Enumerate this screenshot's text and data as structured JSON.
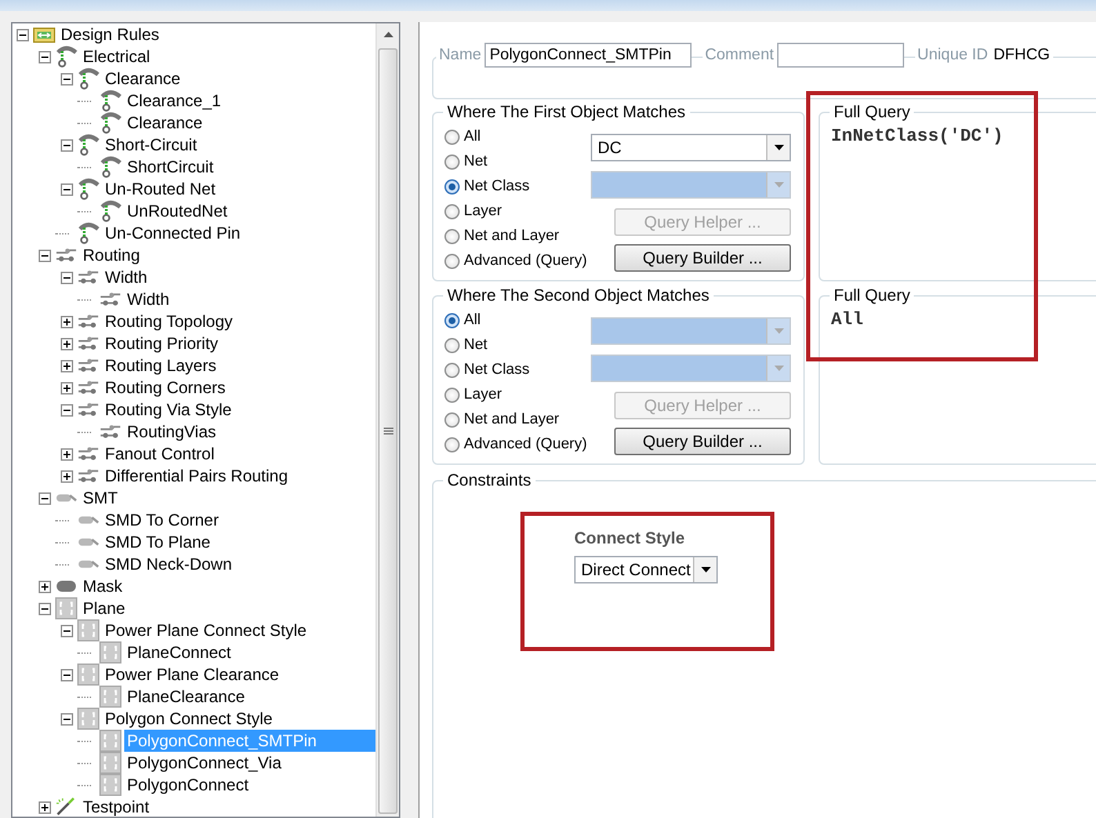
{
  "tree": [
    {
      "label": "Design Rules",
      "kind": "folder",
      "expanded": true,
      "selected": false,
      "children": [
        {
          "label": "Electrical",
          "kind": "electrical",
          "expanded": true,
          "selected": false,
          "children": [
            {
              "label": "Clearance",
              "kind": "electrical",
              "expanded": true,
              "selected": false,
              "children": [
                {
                  "label": "Clearance_1",
                  "kind": "electrical",
                  "selected": false
                },
                {
                  "label": "Clearance",
                  "kind": "electrical",
                  "selected": false
                }
              ]
            },
            {
              "label": "Short-Circuit",
              "kind": "electrical",
              "expanded": true,
              "selected": false,
              "children": [
                {
                  "label": "ShortCircuit",
                  "kind": "electrical",
                  "selected": false
                }
              ]
            },
            {
              "label": "Un-Routed Net",
              "kind": "electrical",
              "expanded": true,
              "selected": false,
              "children": [
                {
                  "label": "UnRoutedNet",
                  "kind": "electrical",
                  "selected": false
                }
              ]
            },
            {
              "label": "Un-Connected Pin",
              "kind": "electrical",
              "selected": false
            }
          ]
        },
        {
          "label": "Routing",
          "kind": "routing",
          "expanded": true,
          "selected": false,
          "children": [
            {
              "label": "Width",
              "kind": "routing",
              "expanded": true,
              "selected": false,
              "children": [
                {
                  "label": "Width",
                  "kind": "routing",
                  "selected": false
                }
              ]
            },
            {
              "label": "Routing Topology",
              "kind": "routing",
              "expanded": false,
              "selected": false
            },
            {
              "label": "Routing Priority",
              "kind": "routing",
              "expanded": false,
              "selected": false
            },
            {
              "label": "Routing Layers",
              "kind": "routing",
              "expanded": false,
              "selected": false
            },
            {
              "label": "Routing Corners",
              "kind": "routing",
              "expanded": false,
              "selected": false
            },
            {
              "label": "Routing Via Style",
              "kind": "routing",
              "expanded": true,
              "selected": false,
              "children": [
                {
                  "label": "RoutingVias",
                  "kind": "routing",
                  "selected": false
                }
              ]
            },
            {
              "label": "Fanout Control",
              "kind": "routing",
              "expanded": false,
              "selected": false
            },
            {
              "label": "Differential Pairs Routing",
              "kind": "routing",
              "expanded": false,
              "selected": false
            }
          ]
        },
        {
          "label": "SMT",
          "kind": "smt",
          "expanded": true,
          "selected": false,
          "children": [
            {
              "label": "SMD To Corner",
              "kind": "smt",
              "selected": false
            },
            {
              "label": "SMD To Plane",
              "kind": "smt",
              "selected": false
            },
            {
              "label": "SMD Neck-Down",
              "kind": "smt",
              "selected": false
            }
          ]
        },
        {
          "label": "Mask",
          "kind": "mask",
          "expanded": false,
          "selected": false
        },
        {
          "label": "Plane",
          "kind": "plane",
          "expanded": true,
          "selected": false,
          "children": [
            {
              "label": "Power Plane Connect Style",
              "kind": "plane",
              "expanded": true,
              "selected": false,
              "children": [
                {
                  "label": "PlaneConnect",
                  "kind": "plane",
                  "selected": false
                }
              ]
            },
            {
              "label": "Power Plane Clearance",
              "kind": "plane",
              "expanded": true,
              "selected": false,
              "children": [
                {
                  "label": "PlaneClearance",
                  "kind": "plane",
                  "selected": false
                }
              ]
            },
            {
              "label": "Polygon Connect Style",
              "kind": "plane",
              "expanded": true,
              "selected": false,
              "children": [
                {
                  "label": "PolygonConnect_SMTPin",
                  "kind": "plane",
                  "selected": true
                },
                {
                  "label": "PolygonConnect_Via",
                  "kind": "plane",
                  "selected": false
                },
                {
                  "label": "PolygonConnect",
                  "kind": "plane",
                  "selected": false
                }
              ]
            }
          ]
        },
        {
          "label": "Testpoint",
          "kind": "testpoint",
          "expanded": false,
          "selected": false
        }
      ]
    }
  ],
  "editor": {
    "name_label": "Name",
    "name_value": "PolygonConnect_SMTPin",
    "comment_label": "Comment",
    "unique_id_label": "Unique ID",
    "unique_id_value": "DFHCG"
  },
  "matches": [
    {
      "title": "Where The First Object Matches",
      "options": [
        {
          "label": "All",
          "selected": false
        },
        {
          "label": "Net",
          "selected": false
        },
        {
          "label": "Net Class",
          "selected": true
        },
        {
          "label": "Layer",
          "selected": false
        },
        {
          "label": "Net and Layer",
          "selected": false
        },
        {
          "label": "Advanced (Query)",
          "selected": false
        }
      ],
      "object_select": {
        "value": "DC",
        "disabled": false
      },
      "second_select": {
        "disabled": true
      },
      "query_helper": {
        "label": "Query Helper ...",
        "disabled": true
      },
      "query_builder": {
        "label": "Query Builder ...",
        "disabled": false
      },
      "full_query": {
        "title": "Full Query",
        "text": "InNetClass('DC')",
        "highlighted": true
      }
    },
    {
      "title": "Where The Second Object Matches",
      "options": [
        {
          "label": "All",
          "selected": true
        },
        {
          "label": "Net",
          "selected": false
        },
        {
          "label": "Net Class",
          "selected": false
        },
        {
          "label": "Layer",
          "selected": false
        },
        {
          "label": "Net and Layer",
          "selected": false
        },
        {
          "label": "Advanced (Query)",
          "selected": false
        }
      ],
      "object_select": {
        "disabled": true
      },
      "second_select": {
        "disabled": true
      },
      "query_helper": {
        "label": "Query Helper ...",
        "disabled": true
      },
      "query_builder": {
        "label": "Query Builder ...",
        "disabled": false
      },
      "full_query": {
        "title": "Full Query",
        "text": "All"
      }
    }
  ],
  "constraints": {
    "title": "Constraints",
    "connect_style_label": "Connect Style",
    "connect_style_value": "Direct Connect",
    "highlighted": true
  }
}
